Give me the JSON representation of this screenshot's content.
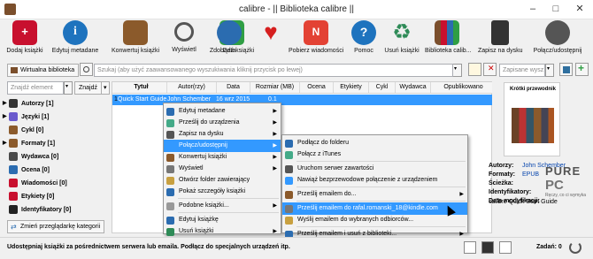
{
  "window": {
    "title": "calibre - || Biblioteka calibre ||"
  },
  "window_controls": [
    "–",
    "□",
    "✕"
  ],
  "toolbar": [
    {
      "label": "Dodaj książki",
      "icon": "add-book-icon",
      "color": "#c8102e"
    },
    {
      "label": "Edytuj metadane",
      "icon": "info-icon",
      "color": "#1e73be"
    },
    {
      "label": "Konwertuj książki",
      "icon": "convert-book-icon",
      "color": "#8b5a2b"
    },
    {
      "label": "Wyświetl",
      "icon": "magnifier-icon",
      "color": "#555555"
    },
    {
      "label": "Zdobądź książki",
      "icon": "shopping-cart-icon",
      "color": "#2f9e44"
    },
    {
      "label": "Data",
      "icon": "globe-icon",
      "color": "#2b6cb0"
    },
    {
      "label": "",
      "icon": "heart-icon",
      "color": "#d61f1f"
    },
    {
      "label": "Pobierz wiadomości",
      "icon": "news-icon",
      "color": "#e34234"
    },
    {
      "label": "Pomoc",
      "icon": "help-icon",
      "color": "#1e73be"
    },
    {
      "label": "Usuń książki",
      "icon": "recycle-icon",
      "color": "#2e8b57"
    },
    {
      "label": "Biblioteka calib...",
      "icon": "library-icon",
      "color": "#7b4f2c"
    },
    {
      "label": "Zapisz na dysku",
      "icon": "save-disk-icon",
      "color": "#333333"
    },
    {
      "label": "Połącz/udostępnij",
      "icon": "connect-share-icon",
      "color": "#555555"
    }
  ],
  "bar2": {
    "library_button": "Wirtualna biblioteka",
    "search_placeholder": "Szukaj (aby użyć zaawansowanego wyszukiwania kliknij przycisk po lewej)",
    "saved_search_placeholder": "Zapisane wysz...",
    "find_placeholder": "Znajdź element",
    "find_button": "Znajdź"
  },
  "sidebar": [
    {
      "label": "Autorzy [1]",
      "icon": "person-icon",
      "color": "#333333",
      "expanded": true
    },
    {
      "label": "Języki [1]",
      "icon": "language-icon",
      "color": "#6a5acd",
      "expanded": true
    },
    {
      "label": "Cykl [0]",
      "icon": "series-icon",
      "color": "#8b5a2b",
      "expanded": false
    },
    {
      "label": "Formaty [1]",
      "icon": "formats-icon",
      "color": "#8b5a2b",
      "expanded": true
    },
    {
      "label": "Wydawca [0]",
      "icon": "publisher-icon",
      "color": "#4a4a4a",
      "expanded": false
    },
    {
      "label": "Ocena [0]",
      "icon": "rating-icon",
      "color": "#2b6cb0",
      "expanded": false
    },
    {
      "label": "Wiadomości [0]",
      "icon": "news-icon",
      "color": "#c8102e",
      "expanded": false
    },
    {
      "label": "Etykiety [0]",
      "icon": "tags-icon",
      "color": "#c8102e",
      "expanded": false
    },
    {
      "label": "Identyfikatory [0]",
      "icon": "id-icon",
      "color": "#222222",
      "expanded": false
    }
  ],
  "sidebar_button": "Zmień przeglądarkę kategorii",
  "table": {
    "columns": [
      "Tytuł",
      "Autor(rzy)",
      "Data",
      "Rozmiar (MB)",
      "Ocena",
      "Etykiety",
      "Cykl",
      "Wydawca",
      "Opublikowano"
    ],
    "rows": [
      {
        "num": "1",
        "title": "Quick Start Guide",
        "author": "John Schember",
        "date": "16 wrz 2015",
        "size": "0.1"
      }
    ]
  },
  "context_menu": [
    {
      "label": "Edytuj metadane",
      "arrow": true
    },
    {
      "label": "Prześlij do urządzenia",
      "arrow": true
    },
    {
      "label": "Zapisz na dysku",
      "arrow": true
    },
    {
      "label": "Połącz/udostępnij",
      "arrow": true,
      "highlighted": true
    },
    {
      "label": "Konwertuj książki",
      "arrow": true
    },
    {
      "label": "Wyświetl",
      "arrow": true
    },
    {
      "label": "Otwórz folder zawierający",
      "arrow": false
    },
    {
      "label": "Pokaż szczegóły książki",
      "arrow": false
    },
    {
      "label": "Podobne książki...",
      "arrow": true
    },
    {
      "label": "Edytuj książkę",
      "arrow": false
    },
    {
      "label": "Usuń książki",
      "arrow": true
    }
  ],
  "submenu": [
    {
      "label": "Podłącz do folderu",
      "arrow": false
    },
    {
      "label": "Połącz z iTunes",
      "arrow": false
    },
    {
      "label": "Uruchom serwer zawartości",
      "arrow": false
    },
    {
      "label": "Nawiąż bezprzewodowe połączenie z urządzeniem",
      "arrow": false
    },
    {
      "label": "Prześlij emailem do...",
      "arrow": true
    },
    {
      "label": "Prześlij emailem do rafal.romanski_18@kindle.com",
      "arrow": false,
      "highlighted": true
    },
    {
      "label": "Wyślij emailem do wybranych odbiorców...",
      "arrow": false
    },
    {
      "label": "Prześlij emailem i usuń z biblioteki...",
      "arrow": true
    }
  ],
  "details": {
    "cover_title": "Krótki przewodnik",
    "author_label": "Autorzy:",
    "author_value": "John Schember",
    "formats_label": "Formaty:",
    "formats_value": "EPUB",
    "lines": [
      "Ścieżka:",
      "Identyfikatory:",
      "Data modyfikacji:"
    ],
    "summary": "calibre Quick Start Guide"
  },
  "watermark": {
    "line1": "PURE",
    "line2": "PC",
    "tagline": "Ręczy, co ci wymyka"
  },
  "status": {
    "text": "Udostępniaj książki za pośrednictwem serwera lub emaila. Podłącz do specjalnych urządzeń itp.",
    "jobs_label": "Zadań: 0"
  }
}
